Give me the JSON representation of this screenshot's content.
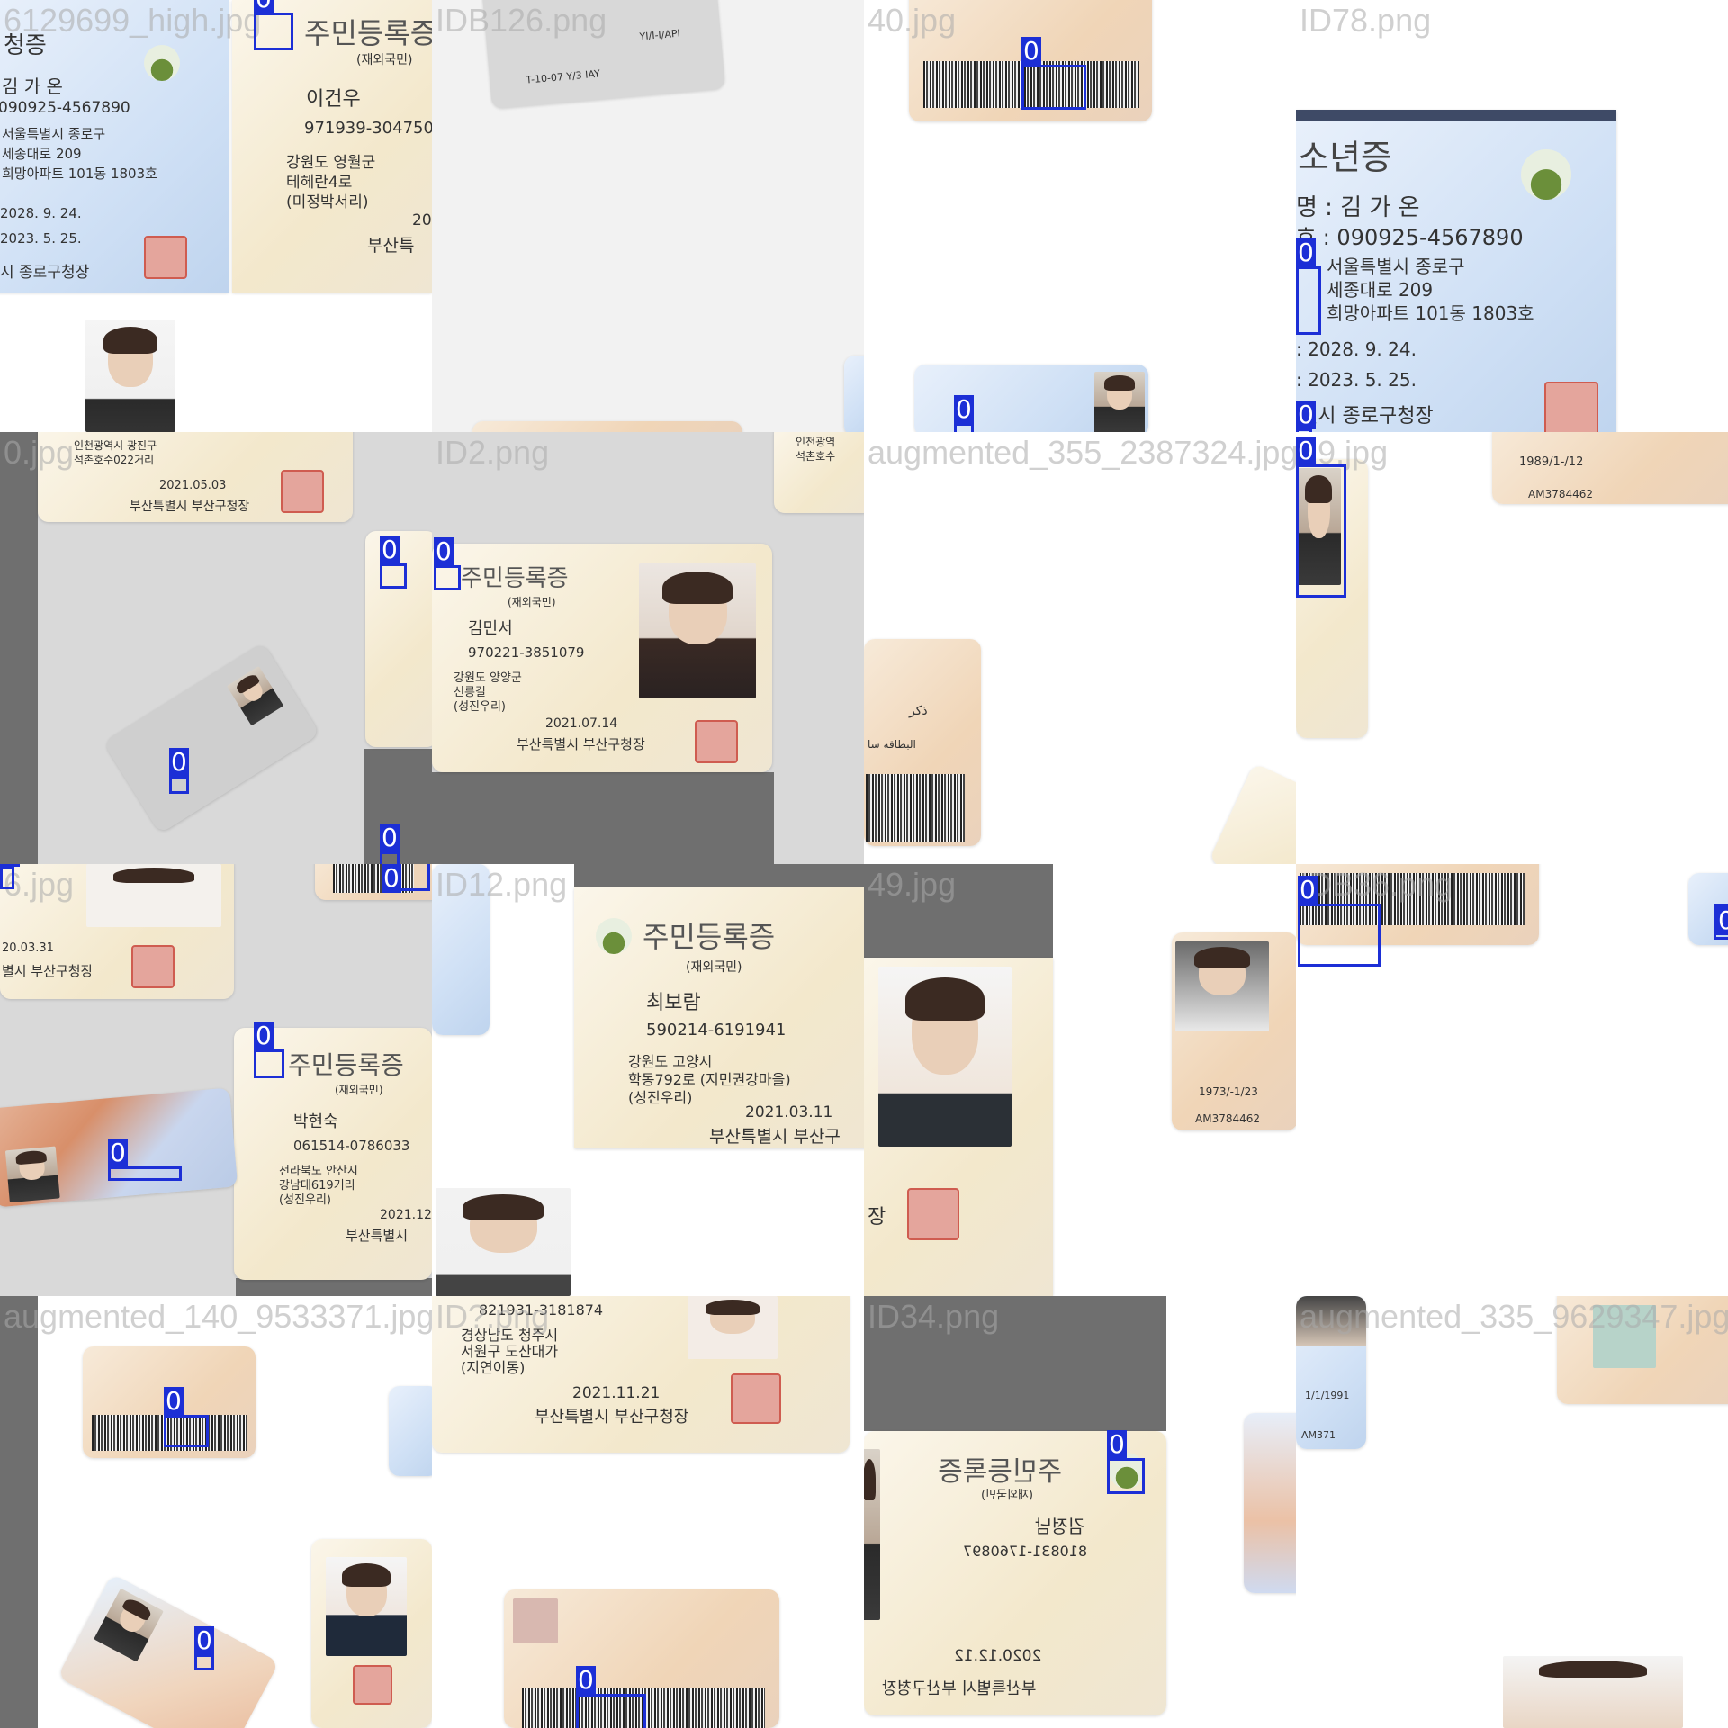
{
  "tiles": [
    {
      "filename": "6129699_high.jpg",
      "text": [
        "주민등록증",
        "(재외국민)",
        "이건우",
        "971939-304750",
        "강원도 영월군",
        "테헤란4로",
        "(미정박서리)",
        "20",
        "부산특",
        "김 가 온",
        "090925-4567890",
        "서울특별시 종로구",
        "세종대로 209",
        "희망아파트 101동 1803호",
        "2028. 9. 24.",
        "2023. 5. 25.",
        "시 종로구청장"
      ],
      "detections": [
        "0"
      ]
    },
    {
      "filename": "IDB126.png",
      "text": [
        "YI/I-I/API",
        "T-10-07 Y/3 IAY"
      ],
      "detections": []
    },
    {
      "filename": "40.jpg",
      "text": [],
      "detections": [
        "0",
        "0"
      ]
    },
    {
      "filename": "ID78.png",
      "text": [
        "소년증",
        "명 : 김 가 온",
        "호 : 090925-4567890",
        "서울특별시 종로구",
        "세종대로 209",
        "희망아파트 101동 1803호",
        ": 2028. 9. 24.",
        ": 2023. 5. 25.",
        "별시 종로구청장"
      ],
      "detections": [
        "0",
        "0"
      ]
    },
    {
      "filename": "0.jpg",
      "text": [
        "인천광역시 광진구",
        "석촌호수022거리",
        "2021.05.03",
        "부산특별시 부산구청장"
      ],
      "detections": [
        "0",
        "0",
        "0"
      ]
    },
    {
      "filename": "ID2.png",
      "text": [
        "주민등록증",
        "(재외국민)",
        "김민서",
        "970221-3851079",
        "강원도 양양군",
        "선릉길",
        "(성진우리)",
        "2021.07.14",
        "부산특별시 부산구청장",
        "인천광역",
        "석촌호수"
      ],
      "detections": [
        "0"
      ]
    },
    {
      "filename": "augmented_355_2387324.jpg",
      "text": [
        "ذكر",
        "البطاقة سا"
      ],
      "detections": []
    },
    {
      "filename": "29.jpg",
      "text": [
        "1989/1-/12",
        "AM3784462"
      ],
      "detections": [
        "0"
      ]
    },
    {
      "filename": "6.jpg",
      "text": [
        "20.03.31",
        "별시 부산구청장",
        "주민등록증",
        "(재외국민)",
        "박현숙",
        "061514-0786033",
        "전라북도 안산시",
        "강남대619거리",
        "(성진우리)",
        "2021.12",
        "부산특별시"
      ],
      "detections": [
        "0",
        "0",
        "0",
        "0"
      ]
    },
    {
      "filename": "ID12.png",
      "text": [
        "주민등록증",
        "(재외국민)",
        "최보람",
        "590214-6191941",
        "강원도 고양시",
        "학동792로 (지민권강마을)",
        "(성진우리)",
        "2021.03.11",
        "부산특별시 부산구"
      ],
      "detections": []
    },
    {
      "filename": "49.jpg",
      "text": [
        "1973/-1/23",
        "AM3784462",
        "장"
      ],
      "detections": []
    },
    {
      "filename": "IDB36.png",
      "text": [],
      "detections": [
        "0",
        "0"
      ]
    },
    {
      "filename": "augmented_140_9533371.jpg",
      "text": [],
      "detections": [
        "0",
        "0"
      ]
    },
    {
      "filename": "ID?.png",
      "text": [
        "821931-3181874",
        "경상남도 청주시",
        "서원구 도산대가",
        "(지연이동)",
        "2021.11.21",
        "부산특별시 부산구청장"
      ],
      "detections": [
        "0"
      ]
    },
    {
      "filename": "ID34.png",
      "text": [
        "주민등록증",
        "(재외국민)",
        "김정남",
        "810831-1760897",
        "부산특별시 부산구청장",
        "2020.12.12"
      ],
      "detections": [
        "0"
      ]
    },
    {
      "filename": "augmented_335_9629347.jpg",
      "text": [
        "1/1/1991",
        "AM371"
      ],
      "detections": []
    }
  ]
}
